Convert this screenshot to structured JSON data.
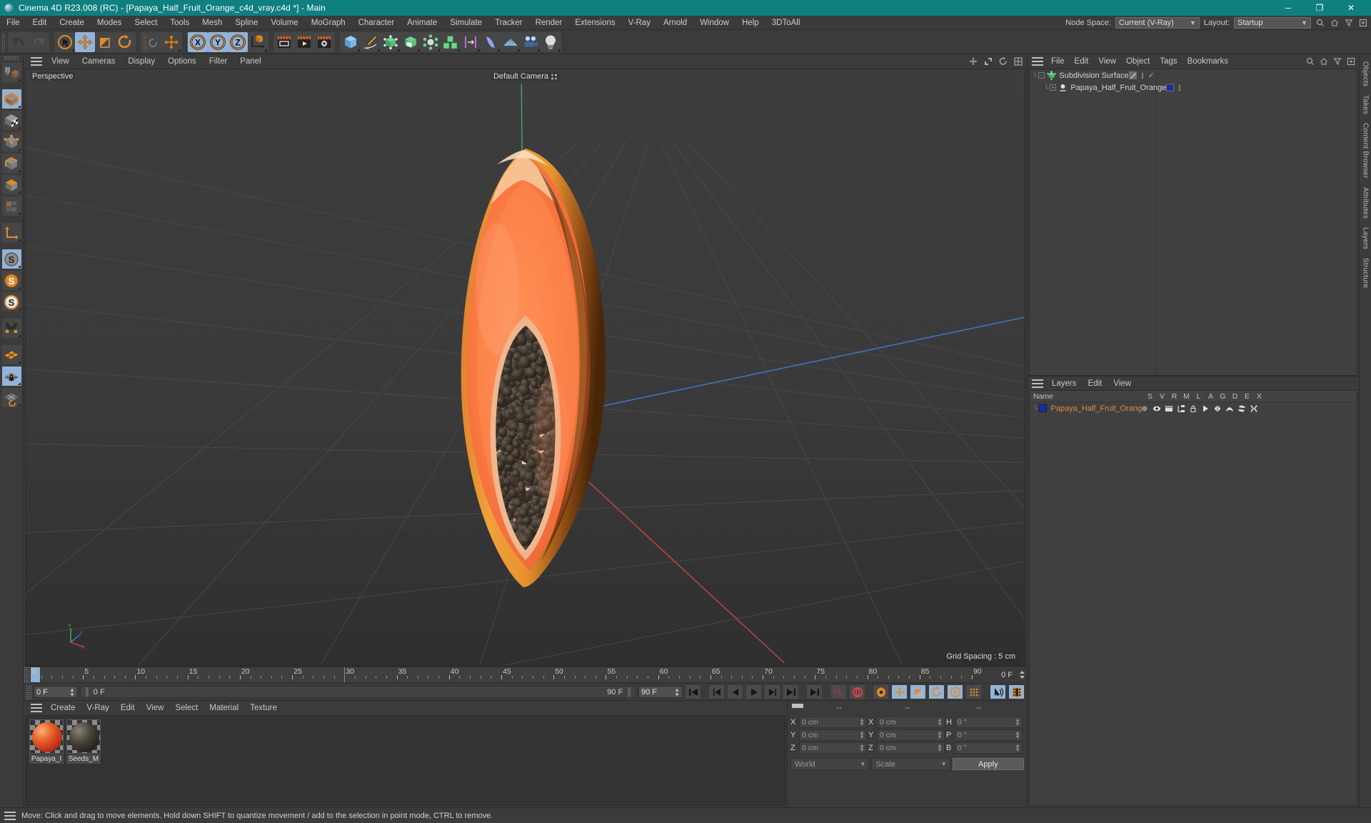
{
  "window": {
    "title": "Cinema 4D R23.008 (RC) - [Papaya_Half_Fruit_Orange_c4d_vray.c4d *] - Main",
    "logo_icon": "cinema4d-logo-icon",
    "minimize_label": "─",
    "maximize_label": "❐",
    "close_label": "✕",
    "titlebar_color": "#0f7f80"
  },
  "menubar": {
    "items": [
      "File",
      "Edit",
      "Create",
      "Modes",
      "Select",
      "Tools",
      "Mesh",
      "Spline",
      "Volume",
      "MoGraph",
      "Character",
      "Animate",
      "Simulate",
      "Tracker",
      "Render",
      "Extensions",
      "V-Ray",
      "Arnold",
      "Window",
      "Help",
      "3DToAll"
    ],
    "node_space_label": "Node Space:",
    "node_space_value": "Current (V-Ray)",
    "layout_label": "Layout:",
    "layout_value": "Startup",
    "search_icon": "search-icon",
    "home_icon": "home-icon",
    "filter_icon": "filter-icon",
    "plus_icon": "plus-box-icon"
  },
  "toolbar": {
    "groups": [
      {
        "name": "history",
        "buttons": [
          {
            "icon": "undo-icon",
            "label": "Undo",
            "selected": false
          },
          {
            "icon": "redo-icon",
            "label": "Redo",
            "selected": false
          }
        ]
      },
      {
        "name": "transform-tools",
        "buttons": [
          {
            "icon": "select-cursor-icon",
            "label": "Live Selection",
            "selected": false
          },
          {
            "icon": "move-icon",
            "label": "Move",
            "selected": true
          },
          {
            "icon": "scale-icon",
            "label": "Scale",
            "selected": false
          },
          {
            "icon": "rotate-icon",
            "label": "Rotate",
            "selected": false
          }
        ]
      },
      {
        "name": "psr",
        "buttons": [
          {
            "icon": "psr-icon",
            "label": "PSR",
            "selected": false
          },
          {
            "icon": "move-world-icon",
            "label": "Move World",
            "selected": false
          }
        ]
      },
      {
        "name": "axis-locks",
        "buttons": [
          {
            "icon": "x-axis-icon",
            "label": "X Axis",
            "selected": true
          },
          {
            "icon": "y-axis-icon",
            "label": "Y Axis",
            "selected": true
          },
          {
            "icon": "z-axis-icon",
            "label": "Z Axis",
            "selected": true
          },
          {
            "icon": "world-coord-icon",
            "label": "World Coordinate System",
            "selected": false
          }
        ]
      },
      {
        "name": "render",
        "buttons": [
          {
            "icon": "render-view-icon",
            "label": "Render View",
            "selected": false
          },
          {
            "icon": "render-picture-viewer-icon",
            "label": "Render to Picture Viewer",
            "selected": false
          },
          {
            "icon": "render-settings-icon",
            "label": "Render Settings",
            "selected": false
          }
        ]
      },
      {
        "name": "objects",
        "buttons": [
          {
            "icon": "cube-primitive-icon",
            "label": "Add Cube Object",
            "selected": false
          },
          {
            "icon": "spline-pen-icon",
            "label": "Spline Pen",
            "selected": false
          },
          {
            "icon": "nurbs-icon",
            "label": "Subdivision Surface",
            "selected": false
          },
          {
            "icon": "scene-object-icon",
            "label": "Scene Objects",
            "selected": false
          },
          {
            "icon": "deformer-icon",
            "label": "Bend Deformer",
            "selected": false
          },
          {
            "icon": "array-icon",
            "label": "Array",
            "selected": false
          },
          {
            "icon": "field-icon",
            "label": "Fields",
            "selected": false
          },
          {
            "icon": "cloth-icon",
            "label": "Cloth Surface",
            "selected": false
          },
          {
            "icon": "floor-icon",
            "label": "Floor",
            "selected": false
          },
          {
            "icon": "camera-icon",
            "label": "Camera",
            "selected": false
          },
          {
            "icon": "light-icon",
            "label": "Light",
            "selected": false
          }
        ]
      }
    ]
  },
  "left_toolbar": {
    "buttons": [
      {
        "icon": "make-editable-icon",
        "label": "Make Editable",
        "selected": false,
        "gap_after": true
      },
      {
        "icon": "model-mode-icon",
        "label": "Model Mode",
        "selected": true
      },
      {
        "icon": "texture-mode-icon",
        "label": "Texture Mode",
        "selected": false
      },
      {
        "icon": "points-mode-icon",
        "label": "Points Mode",
        "selected": false
      },
      {
        "icon": "edges-mode-icon",
        "label": "Edges Mode",
        "selected": false
      },
      {
        "icon": "polygons-mode-icon",
        "label": "Polygons Mode",
        "selected": false
      },
      {
        "icon": "uv-mode-icon",
        "label": "UV Polygons",
        "selected": false,
        "gap_after": true
      },
      {
        "icon": "axis-mode-icon",
        "label": "Enable Axis Modification",
        "selected": false,
        "gap_after": true
      },
      {
        "icon": "s-gray-icon",
        "label": "Object Axis",
        "selected": true
      },
      {
        "icon": "s-orange-icon",
        "label": "World Axis",
        "selected": false
      },
      {
        "icon": "s-outline-icon",
        "label": "Object/World",
        "selected": false,
        "gap_after": true
      },
      {
        "icon": "magnet-icon",
        "label": "Magnet / Soft Selection",
        "selected": false,
        "gap_after": true
      },
      {
        "icon": "grid-orange-icon",
        "label": "Enable Snap",
        "selected": false
      },
      {
        "icon": "grid-lock-icon",
        "label": "Lock Workplane",
        "selected": true
      },
      {
        "icon": "grid-rotate-icon",
        "label": "Workplane",
        "selected": false
      }
    ]
  },
  "viewport": {
    "menus": [
      "View",
      "Cameras",
      "Display",
      "Options",
      "Filter",
      "Panel"
    ],
    "hamburger_icon": "hamburger-icon",
    "right_icons": [
      "move-view-icon",
      "scale-view-icon",
      "rotate-view-icon",
      "maximize-view-icon"
    ],
    "label": "Perspective",
    "camera_label": "Default Camera",
    "camera_badge_icon": "camera-points-icon",
    "grid_spacing": "Grid Spacing : 5 cm",
    "axis_gizmo": {
      "x": "X",
      "y": "Y",
      "z": "Z"
    },
    "model_name": "papaya-half-fruit-orange"
  },
  "timeline": {
    "start_frame": "0",
    "end_frame": "90 F",
    "ticks": [
      0,
      5,
      10,
      15,
      20,
      25,
      30,
      35,
      40,
      45,
      50,
      55,
      60,
      65,
      70,
      75,
      80,
      85,
      90
    ],
    "current_frame_right": "0 F",
    "current_frame_field": "0 F",
    "preview_min_field": "0 F",
    "preview_max_label": "90 F",
    "preview_max_field": "90 F",
    "playhead_frame": 0
  },
  "transport": {
    "buttons": [
      {
        "icon": "go-to-start-icon",
        "label": "Go to Start",
        "selected": false
      },
      {
        "icon": "go-to-previous-key-icon",
        "label": "Go to Previous Key",
        "selected": false
      },
      {
        "icon": "step-back-icon",
        "label": "Go to Previous Frame",
        "selected": false
      },
      {
        "icon": "play-icon",
        "label": "Play Forwards",
        "selected": false
      },
      {
        "icon": "step-forward-icon",
        "label": "Go to Next Frame",
        "selected": false
      },
      {
        "icon": "go-to-next-key-icon",
        "label": "Go to Next Key",
        "selected": false
      },
      {
        "icon": "go-to-end-icon",
        "label": "Go to End",
        "selected": false
      }
    ],
    "record_buttons": [
      {
        "icon": "autokey-key-icon",
        "label": "Record Active Objects",
        "selected": false
      },
      {
        "icon": "autokeying-icon",
        "label": "Autokeying",
        "selected": false
      },
      {
        "icon": "keyframe-selection-icon",
        "label": "Keyframe Selection",
        "selected": false
      },
      {
        "icon": "position-key-icon",
        "label": "Position",
        "selected": true
      },
      {
        "icon": "scale-key-icon",
        "label": "Scale",
        "selected": true
      },
      {
        "icon": "rotation-key-icon",
        "label": "Rotation",
        "selected": true
      },
      {
        "icon": "param-key-icon",
        "label": "Parameter",
        "selected": true
      },
      {
        "icon": "pla-key-icon",
        "label": "Point Level Animation",
        "selected": false
      }
    ],
    "extra_buttons": [
      {
        "icon": "sound-icon",
        "label": "Sound",
        "selected": true
      },
      {
        "icon": "film-strip-icon",
        "label": "Timeline",
        "selected": true
      }
    ]
  },
  "material_manager": {
    "menus": [
      "Create",
      "V-Ray",
      "Edit",
      "View",
      "Select",
      "Material",
      "Texture"
    ],
    "hamburger_icon": "hamburger-icon",
    "materials": [
      {
        "name": "Papaya_I",
        "full_name": "Papaya_Material",
        "color": "#c94a1e",
        "type": "papaya"
      },
      {
        "name": "Seeds_M",
        "full_name": "Seeds_Material",
        "color": "#2e2a25",
        "type": "seeds"
      }
    ]
  },
  "coordinates": {
    "hamburger_icon": "hamburger-icon",
    "headers": [
      "--",
      "--",
      "--"
    ],
    "rows": [
      {
        "pos_label": "X",
        "pos_value": "0 cm",
        "size_label": "X",
        "size_value": "0 cm",
        "rot_label": "H",
        "rot_value": "0 °"
      },
      {
        "pos_label": "Y",
        "pos_value": "0 cm",
        "size_label": "Y",
        "size_value": "0 cm",
        "rot_label": "P",
        "rot_value": "0 °"
      },
      {
        "pos_label": "Z",
        "pos_value": "0 cm",
        "size_label": "Z",
        "size_value": "0 cm",
        "rot_label": "B",
        "rot_value": "0 °"
      }
    ],
    "system_value": "World",
    "mode_value": "Scale",
    "apply_label": "Apply"
  },
  "object_manager": {
    "hamburger_icon": "hamburger-icon",
    "menus": [
      "File",
      "Edit",
      "View",
      "Object",
      "Tags",
      "Bookmarks"
    ],
    "icons": [
      "search-icon",
      "home-icon",
      "filter-icon",
      "plus-box-icon"
    ],
    "rows": [
      {
        "name": "Subdivision Surface",
        "icon": "subdivision-surface-icon",
        "depth": 0,
        "expander": "-",
        "tag_type": "slash",
        "check": true,
        "tag_color": null
      },
      {
        "name": "Papaya_Half_Fruit_Orange",
        "icon": "polygon-object-icon",
        "depth": 1,
        "expander": "+",
        "tag_type": "color",
        "check": false,
        "tag_color": "#17309c"
      }
    ]
  },
  "layer_manager": {
    "hamburger_icon": "hamburger-icon",
    "menus": [
      "Layers",
      "Edit",
      "View"
    ],
    "name_header": "Name",
    "columns": [
      "S",
      "V",
      "R",
      "M",
      "L",
      "A",
      "G",
      "D",
      "E",
      "X"
    ],
    "rows": [
      {
        "name": "Papaya_Half_Fruit_Orange",
        "color": "#17309c",
        "text_color": "#e08b3a",
        "icons": [
          "solo-dot-icon",
          "eye-icon",
          "render-icon",
          "manager-icon",
          "lock-icon",
          "animation-icon",
          "generator-icon",
          "deformer-icon",
          "expression-icon",
          "xref-icon"
        ]
      }
    ]
  },
  "right_tabs": [
    "Objects",
    "Takes",
    "Content Browser",
    "Attributes",
    "Layers",
    "Structure"
  ],
  "statusbar": {
    "hamburger_icon": "hamburger-icon",
    "text": "Move: Click and drag to move elements. Hold down SHIFT to quantize movement / add to the selection in point mode, CTRL to remove."
  }
}
